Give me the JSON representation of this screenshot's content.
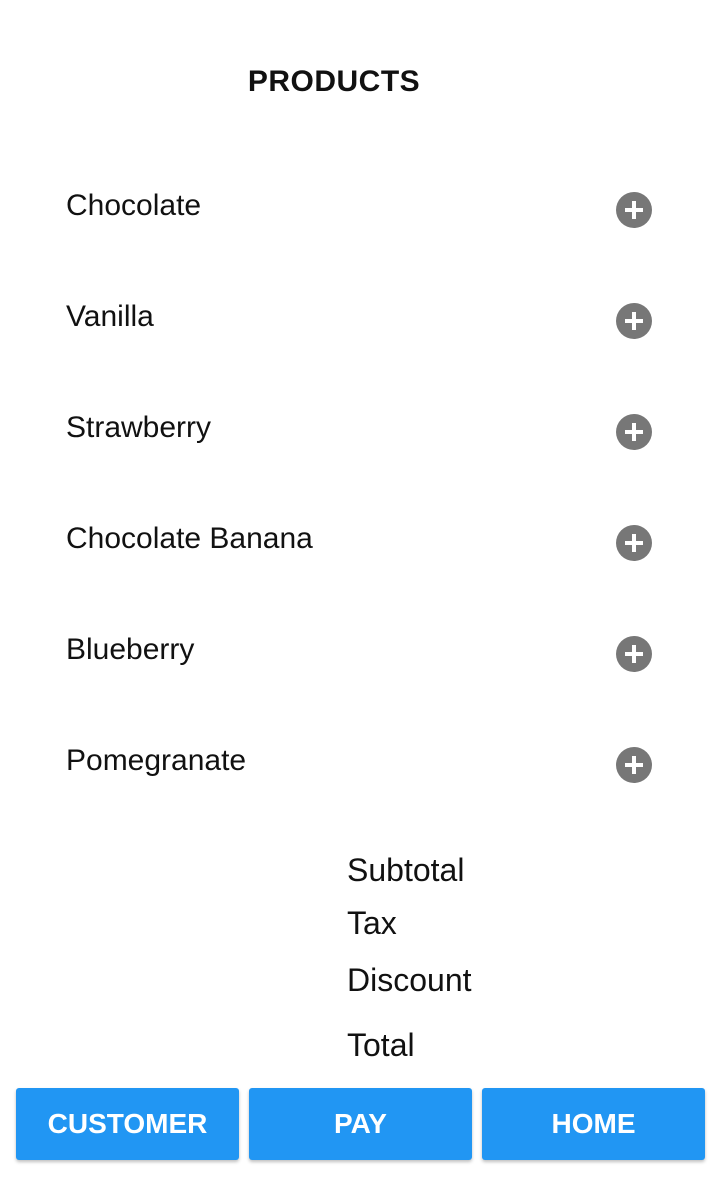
{
  "page_title": "PRODUCTS",
  "products": [
    {
      "name": "Chocolate",
      "action_icon": "add-circle-icon"
    },
    {
      "name": "Vanilla",
      "action_icon": "add-circle-icon"
    },
    {
      "name": "Strawberry",
      "action_icon": "add-circle-icon"
    },
    {
      "name": "Chocolate Banana",
      "action_icon": "add-circle-icon"
    },
    {
      "name": "Blueberry",
      "action_icon": "add-circle-icon"
    },
    {
      "name": "Pomegranate",
      "action_icon": "add-circle-icon"
    }
  ],
  "summary": {
    "subtotal_label": "Subtotal",
    "tax_label": "Tax",
    "discount_label": "Discount",
    "total_label": "Total"
  },
  "actions": {
    "customer_label": "CUSTOMER",
    "pay_label": "PAY",
    "home_label": "HOME"
  },
  "colors": {
    "primary_button": "#2196f3",
    "add_icon": "#777777",
    "text": "#111111",
    "background": "#ffffff"
  }
}
